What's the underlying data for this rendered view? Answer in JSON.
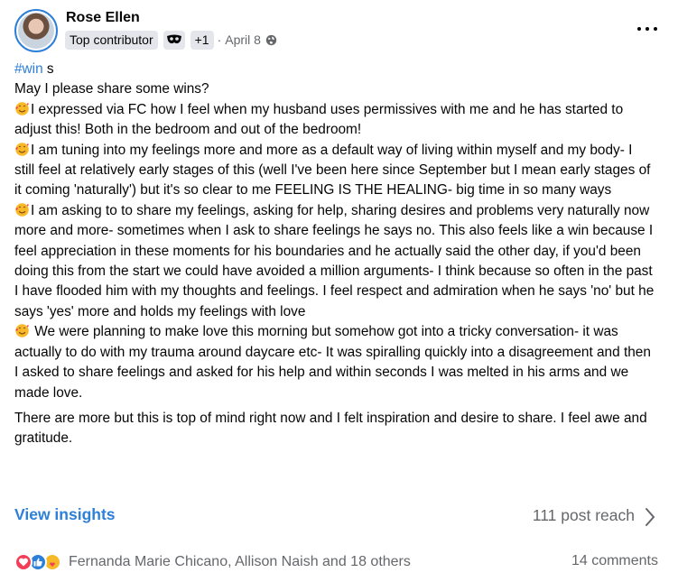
{
  "post": {
    "author": "Rose Ellen",
    "badge": "Top contributor",
    "badge_plus": "+1",
    "date": "April 8",
    "date_separator": "·",
    "hashtag": "#win",
    "hashtag_suffix": " s",
    "intro": "May I please share some wins?",
    "wins": [
      "I expressed via FC how I feel when my husband uses permissives with me and he has started to adjust this! Both in the bedroom and out of the bedroom!",
      "I am tuning into my feelings more and more as a default way of living within myself and my body- I still feel at relatively early stages of this (well I've been here since September but I mean early stages of it coming 'naturally')  but it's so clear to me FEELING IS THE HEALING- big time in so many ways",
      "I am asking to to share my feelings, asking for help, sharing desires and problems very naturally now more and more- sometimes when I ask to share feelings he says no. This also feels like a win because I feel appreciation in these moments for his boundaries and he actually said the other day, if you'd been doing this from the start we could have avoided a million arguments- I think because so often in the past I have flooded him with my thoughts and feelings. I feel respect and admiration when he says 'no' but he says 'yes' more and holds my feelings with love",
      " We were planning to make love this morning but somehow got into a tricky conversation- it was actually to do with my trauma around daycare etc- It was spiralling quickly into a disagreement and then I asked to share feelings and asked for his help and within seconds I was melted in his arms and we made love."
    ],
    "closing": "There are more but this is top of mind right now and I felt inspiration and desire to share. I feel awe and gratitude."
  },
  "footer": {
    "insights_label": "View insights",
    "reach_label": "111 post reach",
    "reaction_names": "Fernanda Marie Chicano, Allison Naish and 18 others",
    "comments_label": "14 comments"
  },
  "icons": {
    "avatar": "user-avatar",
    "badge": "mask-badge-icon",
    "audience": "globe-icon",
    "more": "more-dots-icon",
    "win_emoji": "smiling-face-with-hearts-emoji",
    "chevron": "chevron-right-icon",
    "reactions": [
      "love-reaction-icon",
      "like-reaction-icon",
      "care-reaction-icon"
    ]
  },
  "colors": {
    "link_blue": "#2d7fd8",
    "secondary_text": "#65676b",
    "badge_bg": "#e4e6eb",
    "love_red": "#f33e58",
    "care_yellow": "#f7b928"
  }
}
